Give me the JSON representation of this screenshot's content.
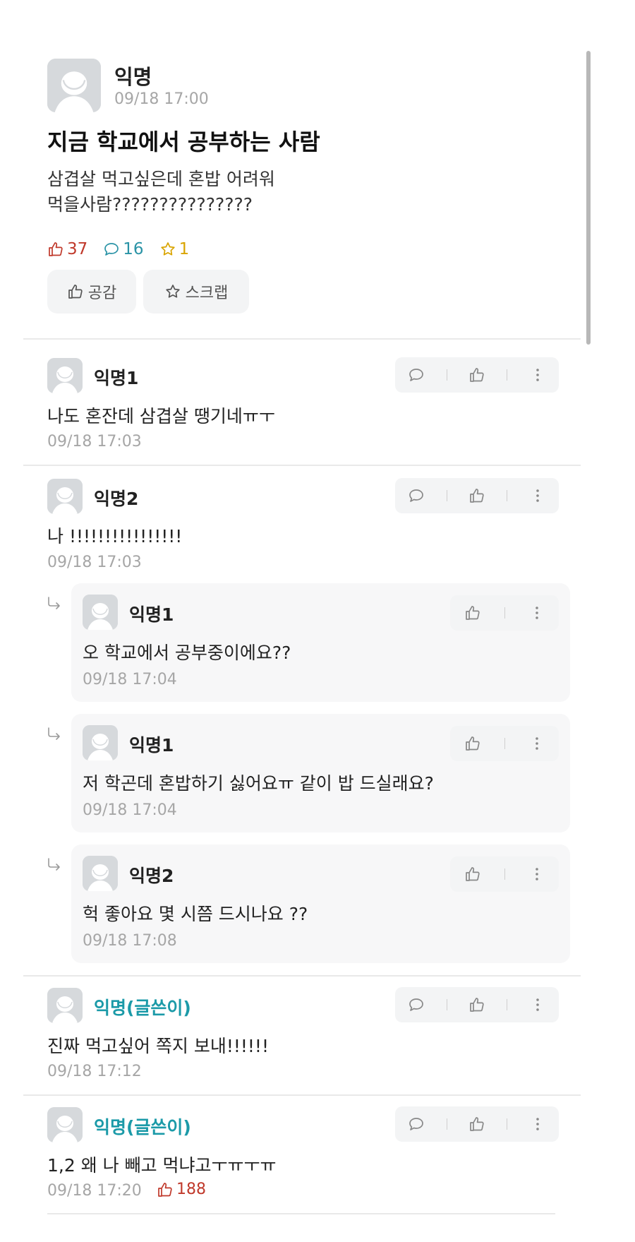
{
  "post": {
    "author": "익명",
    "time": "09/18 17:00",
    "title": "지금 학교에서 공부하는 사람",
    "body_lines": [
      "삼겹살 먹고싶은데 혼밥 어려워",
      "먹을사람???????????????"
    ],
    "likes": "37",
    "comments": "16",
    "scraps": "1",
    "like_button": "공감",
    "scrap_button": "스크랩"
  },
  "comments": [
    {
      "author": "익명1",
      "text": "나도 혼잔데 삼겹살 땡기네ㅠㅜ",
      "time": "09/18 17:03"
    },
    {
      "author": "익명2",
      "text": "나 !!!!!!!!!!!!!!!!",
      "time": "09/18 17:03"
    },
    {
      "author": "익명(글쓴이)",
      "text": "진짜 먹고싶어 쪽지 보내!!!!!!",
      "time": "09/18 17:12"
    },
    {
      "author": "익명(글쓴이)",
      "text": "1,2 왜 나 빼고 먹냐고ㅜㅠㅜㅠ",
      "time": "09/18 17:20",
      "likes": "188"
    }
  ],
  "replies": [
    {
      "author": "익명1",
      "text": "오 학교에서 공부중이에요??",
      "time": "09/18 17:04"
    },
    {
      "author": "익명1",
      "text": "저 학곤데 혼밥하기 싫어요ㅠ 같이 밥 드실래요?",
      "time": "09/18 17:04"
    },
    {
      "author": "익명2",
      "text": "헉 좋아요 몇 시쯤 드시나요 ??",
      "time": "09/18 17:08"
    }
  ],
  "icons": {
    "like": "thumbs-up-icon",
    "comment": "speech-bubble-icon",
    "scrap": "star-icon",
    "more": "more-vertical-icon",
    "reply": "reply-arrow-icon",
    "avatar": "default-avatar-icon"
  },
  "colors": {
    "likes": "#c0392b",
    "comments": "#2a93a6",
    "scraps": "#d9a400",
    "op_author": "#1b9aa8",
    "muted": "#a6a6a6"
  }
}
